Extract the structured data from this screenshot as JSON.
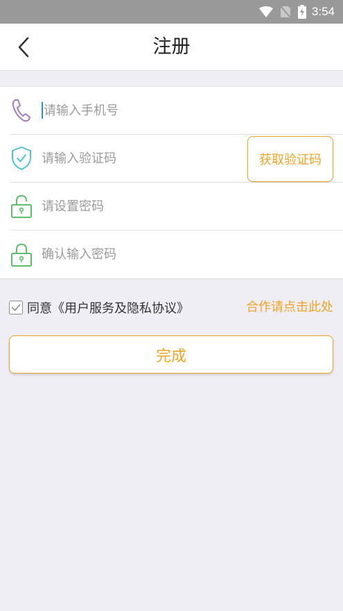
{
  "status_bar": {
    "time": "3:54",
    "icons": [
      "wifi-icon",
      "no-sim-icon",
      "battery-charging-icon"
    ]
  },
  "nav": {
    "back_icon": "chevron-left-icon",
    "title": "注册"
  },
  "form": {
    "phone": {
      "icon": "phone-icon",
      "placeholder": "请输入手机号",
      "value": ""
    },
    "code": {
      "icon": "shield-check-icon",
      "placeholder": "请输入验证码",
      "value": "",
      "button_label": "获取验证码"
    },
    "password": {
      "icon": "lock-icon",
      "placeholder": "请设置密码",
      "value": ""
    },
    "confirm_password": {
      "icon": "lock-icon",
      "placeholder": "确认输入密码",
      "value": ""
    }
  },
  "agreement": {
    "checked": true,
    "label": "同意《用户服务及隐私协议》",
    "cooperation_link": "合作请点击此处"
  },
  "submit_label": "完成",
  "colors": {
    "accent": "#f0a423",
    "background": "#efeef4",
    "phone_icon": "#a77bc4",
    "shield_icon": "#4cc3d6",
    "lock_icon": "#5cc06a"
  }
}
